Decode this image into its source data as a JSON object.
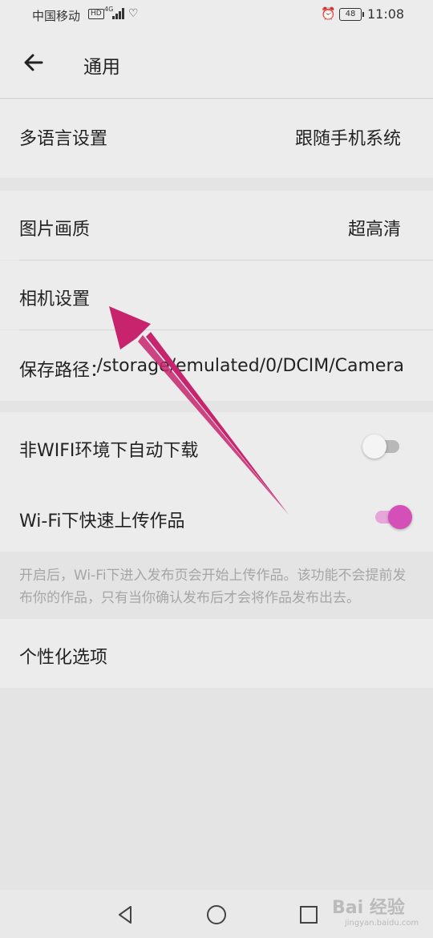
{
  "status_bar": {
    "carrier": "中国移动",
    "hd_badge": "HD",
    "network": "4G",
    "battery_level": "48",
    "time": "11:08",
    "icons": [
      "signal-icon",
      "heart-icon",
      "alarm-icon",
      "battery-icon"
    ]
  },
  "header": {
    "title": "通用",
    "back_icon": "back-arrow-icon"
  },
  "settings": {
    "language": {
      "label": "多语言设置",
      "value": "跟随手机系统"
    },
    "image_quality": {
      "label": "图片画质",
      "value": "超高清"
    },
    "camera": {
      "label": "相机设置"
    },
    "save_path": {
      "label": "保存路径：",
      "value": "/storage/emulated/0/DCIM/Camera"
    },
    "auto_download": {
      "label": "非WIFI环境下自动下载",
      "enabled": false
    },
    "wifi_upload": {
      "label": "Wi-Fi下快速上传作品",
      "enabled": true
    },
    "note": "开启后，Wi-Fi下进入发布页会开始上传作品。该功能不会提前发布你的作品，只有当你确认发布后才会将作品发布出去。",
    "personalization": {
      "label": "个性化选项"
    }
  },
  "nav_bar": {
    "icons": [
      "back-triangle-icon",
      "home-circle-icon",
      "recents-square-icon"
    ]
  },
  "watermark": {
    "text": "Bai 经验",
    "sub": "jingyan.baidu.com"
  },
  "colors": {
    "toggle_on": "#d44fb8",
    "annotation_arrow": "#c8246e"
  }
}
